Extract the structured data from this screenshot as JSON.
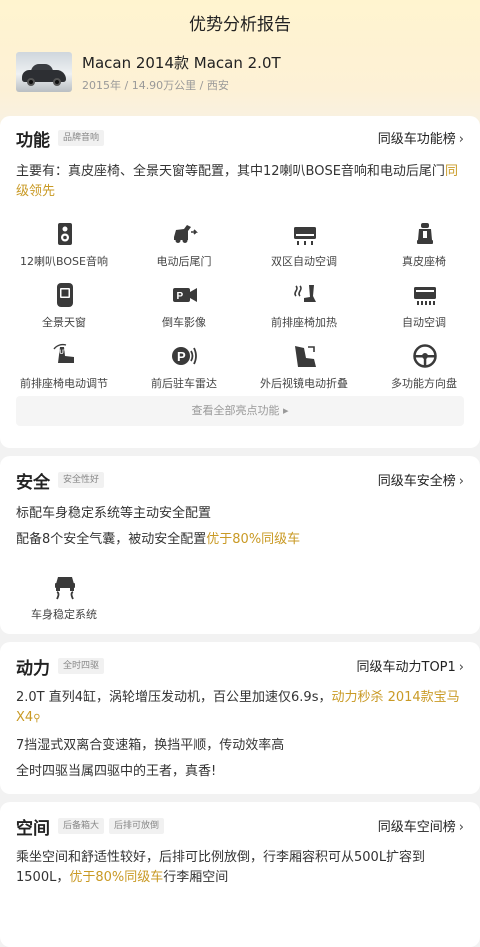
{
  "header": {
    "title": "优势分析报告",
    "car_name": "Macan 2014款 Macan 2.0T",
    "car_meta": "2015年 / 14.90万公里 / 西安"
  },
  "function": {
    "title": "功能",
    "tag": "品牌音响",
    "rank_link": "同级车功能榜",
    "summary_pre": "主要有：真皮座椅、全景天窗等配置，其中12喇叭BOSE音响和电动后尾门",
    "summary_hl": "同级领先",
    "features": [
      {
        "label": "12喇叭BOSE音响",
        "icon": "speaker-icon"
      },
      {
        "label": "电动后尾门",
        "icon": "power-tailgate-icon"
      },
      {
        "label": "双区自动空调",
        "icon": "dual-zone-ac-icon"
      },
      {
        "label": "真皮座椅",
        "icon": "leather-seat-icon"
      },
      {
        "label": "全景天窗",
        "icon": "panoramic-sunroof-icon"
      },
      {
        "label": "倒车影像",
        "icon": "reverse-camera-icon"
      },
      {
        "label": "前排座椅加热",
        "icon": "seat-heating-icon"
      },
      {
        "label": "自动空调",
        "icon": "auto-ac-icon"
      },
      {
        "label": "前排座椅电动调节",
        "icon": "power-seat-icon"
      },
      {
        "label": "前后驻车雷达",
        "icon": "parking-radar-icon"
      },
      {
        "label": "外后视镜电动折叠",
        "icon": "mirror-fold-icon"
      },
      {
        "label": "多功能方向盘",
        "icon": "steering-wheel-icon"
      }
    ],
    "see_all": "查看全部亮点功能 ▸"
  },
  "safety": {
    "title": "安全",
    "tag": "安全性好",
    "rank_link": "同级车安全榜",
    "line1": "标配车身稳定系统等主动安全配置",
    "line2_pre": "配备8个安全气囊，被动安全配置",
    "line2_hl": "优于80%同级车",
    "feature": {
      "label": "车身稳定系统",
      "icon": "stability-control-icon"
    }
  },
  "power": {
    "title": "动力",
    "tag": "全时四驱",
    "rank_link": "同级车动力TOP1",
    "line1_pre": "2.0T 直列4缸，涡轮增压发动机，百公里加速仅6.9s，",
    "line1_hl": "动力秒杀 2014款宝马X4",
    "line2": "7挡湿式双离合变速箱，换挡平顺，传动效率高",
    "line3": "全时四驱当属四驱中的王者，真香!"
  },
  "space": {
    "title": "空间",
    "tag1": "后备箱大",
    "tag2": "后排可放倒",
    "rank_link": "同级车空间榜",
    "line_pre": "乘坐空间和舒适性较好，后排可比例放倒，行李厢容积可从500L扩容到1500L，",
    "line_hl": "优于80%同级车",
    "line_post": "行李厢空间"
  },
  "colors": {
    "accent": "#c99a25",
    "hero_top": "#fff4cf",
    "background": "#f2f2f2"
  }
}
